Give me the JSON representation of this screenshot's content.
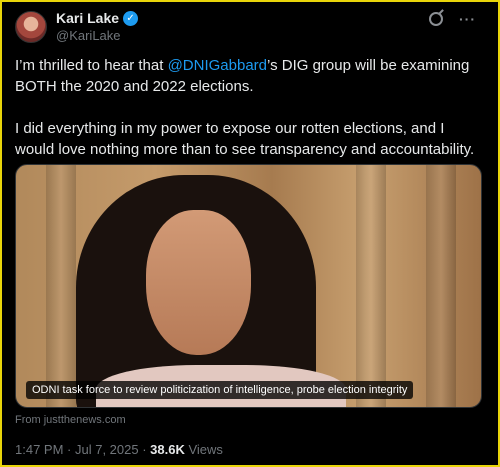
{
  "author": {
    "name": "Kari Lake",
    "handle": "@KariLake",
    "verified": true,
    "avatar_icon": "avatar-photo"
  },
  "tweet": {
    "line1_before": "I’m thrilled to hear that ",
    "mention": "@DNIGabbard",
    "line1_after": "’s DIG group will be examining BOTH the 2020 and 2022 elections.",
    "paragraph2": "I did everything in my power to expose our rotten elections, and I would love nothing more than to see transparency and accountability."
  },
  "media": {
    "caption": "ODNI task force to review politicization of intelligence, probe election integrity",
    "source": "From justthenews.com"
  },
  "meta": {
    "time": "1:47 PM",
    "separator1": " · ",
    "date": "Jul 7, 2025",
    "separator2": " · ",
    "views_count": "38.6K",
    "views_label": " Views"
  },
  "icons": {
    "grok": "grok-icon",
    "more": "more-icon",
    "verified": "verified-badge-icon"
  },
  "colors": {
    "background": "#000000",
    "text": "#e7e9ea",
    "muted": "#71767b",
    "accent": "#1d9bf0",
    "frame_border": "#e8d50a"
  }
}
